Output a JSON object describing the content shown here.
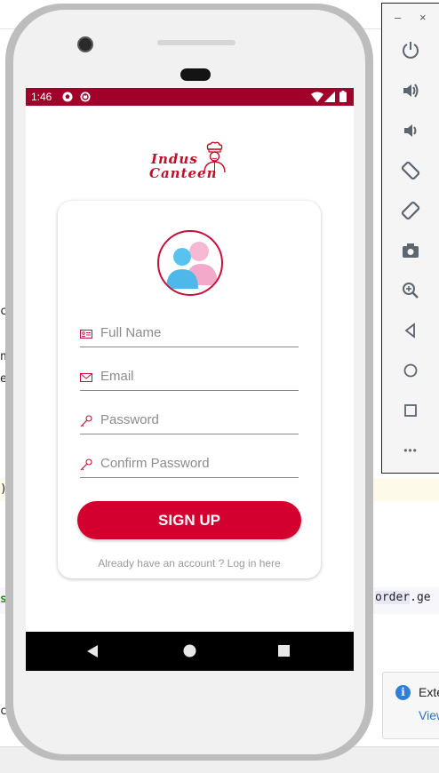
{
  "ide": {
    "fragments": [
      "ca",
      "n",
      "er",
      ")",
      "s",
      "ca"
    ],
    "code_right_prefix": "order",
    "code_right_suffix": ".ge"
  },
  "notification": {
    "title": "Exte",
    "link": "View"
  },
  "emulator_panel": {
    "minimize": "–",
    "close": "×",
    "controls": [
      "power-icon",
      "volume-up-icon",
      "volume-down-icon",
      "rotate-left-icon",
      "rotate-right-icon",
      "camera-icon",
      "zoom-icon",
      "back-icon",
      "home-icon",
      "overview-icon",
      "more-icon"
    ],
    "more_label": "•••"
  },
  "status_bar": {
    "time": "1:46",
    "background": "#a1002b"
  },
  "app": {
    "logo_line1": "Indus",
    "logo_line2": "Canteen",
    "fields": {
      "full_name_placeholder": "Full Name",
      "email_placeholder": "Email",
      "password_placeholder": "Password",
      "confirm_password_placeholder": "Confirm Password"
    },
    "signup_label": "SIGN UP",
    "login_prompt": "Already have an account ? Log in here",
    "accent_color": "#d3002f"
  }
}
